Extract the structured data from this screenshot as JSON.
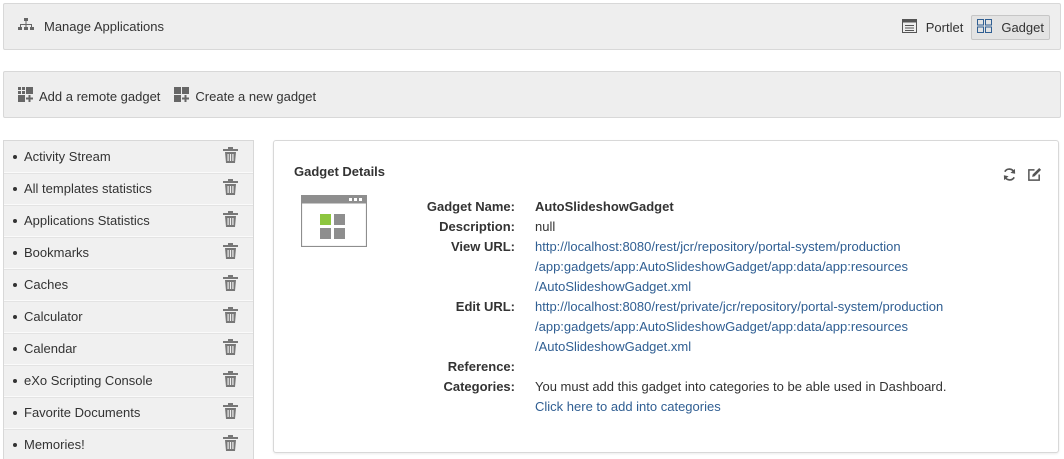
{
  "header": {
    "title": "Manage Applications",
    "portlet_label": "Portlet",
    "gadget_label": "Gadget"
  },
  "toolbar": {
    "add_remote_label": "Add a remote gadget",
    "create_new_label": "Create a new gadget"
  },
  "sidebar": {
    "items": [
      {
        "label": "Activity Stream"
      },
      {
        "label": "All templates statistics"
      },
      {
        "label": "Applications Statistics"
      },
      {
        "label": "Bookmarks"
      },
      {
        "label": "Caches"
      },
      {
        "label": "Calculator"
      },
      {
        "label": "Calendar"
      },
      {
        "label": "eXo Scripting Console"
      },
      {
        "label": "Favorite Documents"
      },
      {
        "label": "Memories!"
      }
    ]
  },
  "details": {
    "title": "Gadget Details",
    "labels": {
      "name": "Gadget Name:",
      "description": "Description:",
      "view_url": "View URL:",
      "edit_url": "Edit URL:",
      "reference": "Reference:",
      "categories": "Categories:"
    },
    "name": "AutoSlideshowGadget",
    "description": "null",
    "view_url_lines": [
      "http://localhost:8080/rest/jcr/repository/portal-system/production",
      "/app:gadgets/app:AutoSlideshowGadget/app:data/app:resources",
      "/AutoSlideshowGadget.xml"
    ],
    "edit_url_lines": [
      "http://localhost:8080/rest/private/jcr/repository/portal-system/production",
      "/app:gadgets/app:AutoSlideshowGadget/app:data/app:resources",
      "/AutoSlideshowGadget.xml"
    ],
    "reference": "",
    "categories_text": "You must add this gadget into categories to be able used in Dashboard.",
    "categories_link": "Click here to add into categories"
  },
  "colors": {
    "link": "#2f5e92",
    "thumb_accent": "#8dc63f",
    "bar_bg": "#eeeeee"
  },
  "icons": {
    "header": "sitemap-icon",
    "portlet": "list-window-icon",
    "gadget": "grid-window-icon",
    "add_remote": "add-grid-icon",
    "create_new": "new-grid-icon",
    "delete": "trash-icon",
    "refresh": "refresh-icon",
    "edit": "edit-icon"
  }
}
